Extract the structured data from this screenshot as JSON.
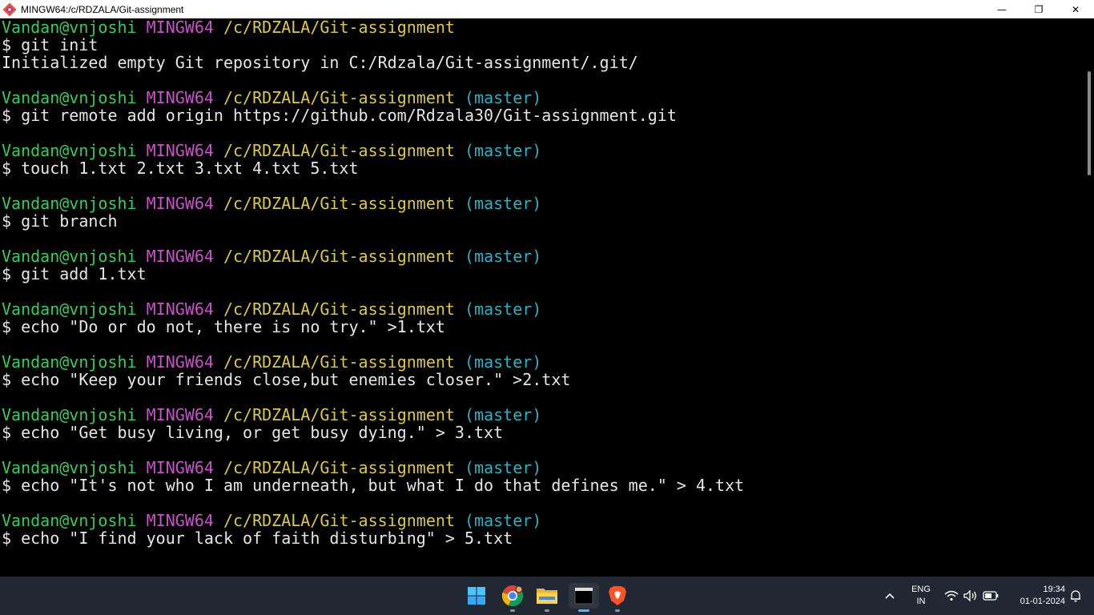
{
  "window": {
    "title": "MINGW64:/c/RDZALA/Git-assignment",
    "controls": {
      "minimize": "—",
      "maximize": "❐",
      "close": "✕"
    }
  },
  "prompt": {
    "user": "Vandan@vnjoshi",
    "system": "MINGW64",
    "path": "/c/RDZALA/Git-assignment",
    "branch": "(master)"
  },
  "colors": {
    "user": "#2fd05b",
    "system": "#c852c8",
    "path": "#dccb3a",
    "branch": "#22b5c6"
  },
  "terminal": {
    "commands": [
      "$ git init",
      "$ git remote add origin https://github.com/Rdzala30/Git-assignment.git",
      "$ touch 1.txt 2.txt 3.txt 4.txt 5.txt",
      "$ git branch",
      "$ git add 1.txt",
      "$ echo \"Do or do not, there is no try.\" >1.txt",
      "$ echo \"Keep your friends close,but enemies closer.\" >2.txt",
      "$ echo \"Get busy living, or get busy dying.\" > 3.txt",
      "$ echo \"It's not who I am underneath, but what I do that defines me.\" > 4.txt",
      "$ echo \"I find your lack of faith disturbing\" > 5.txt"
    ],
    "output_init": "Initialized empty Git repository in C:/Rdzala/Git-assignment/.git/"
  },
  "taskbar": {
    "icons": [
      "windows-start-icon",
      "chrome-icon",
      "file-explorer-icon",
      "terminal-icon",
      "brave-icon"
    ],
    "language": {
      "line1": "ENG",
      "line2": "IN"
    },
    "time": "19:34",
    "date": "01-01-2024"
  }
}
